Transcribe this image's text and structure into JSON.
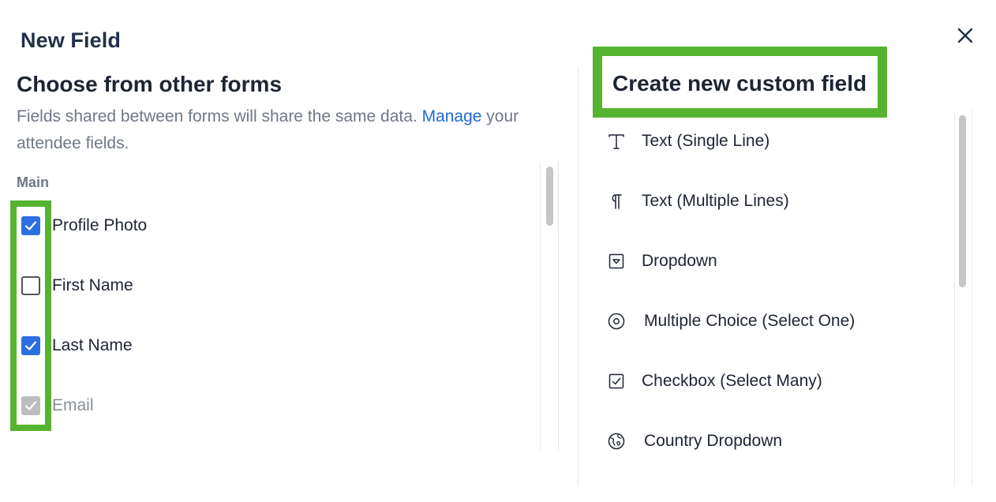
{
  "dialog": {
    "title": "New Field",
    "close_icon": "close-icon"
  },
  "left": {
    "heading": "Choose from other forms",
    "description_before": "Fields shared between forms will share the same data. ",
    "description_link": "Manage",
    "description_after": " your attendee fields.",
    "section_label": "Main",
    "fields": [
      {
        "label": "Profile Photo",
        "state": "checked"
      },
      {
        "label": "First Name",
        "state": "unchecked"
      },
      {
        "label": "Last Name",
        "state": "checked"
      },
      {
        "label": "Email",
        "state": "checked-disabled"
      }
    ],
    "accent_color": "#2c6fe3"
  },
  "right": {
    "heading": "Create new custom field",
    "field_types": [
      {
        "label": "Text (Single Line)",
        "icon": "text-single-line-icon"
      },
      {
        "label": "Text (Multiple Lines)",
        "icon": "pilcrow-icon"
      },
      {
        "label": "Dropdown",
        "icon": "dropdown-icon"
      },
      {
        "label": "Multiple Choice (Select One)",
        "icon": "radio-icon"
      },
      {
        "label": "Checkbox (Select Many)",
        "icon": "checkbox-icon"
      },
      {
        "label": "Country Dropdown",
        "icon": "globe-icon"
      }
    ]
  },
  "annotation": {
    "highlight_color": "#55b330"
  }
}
